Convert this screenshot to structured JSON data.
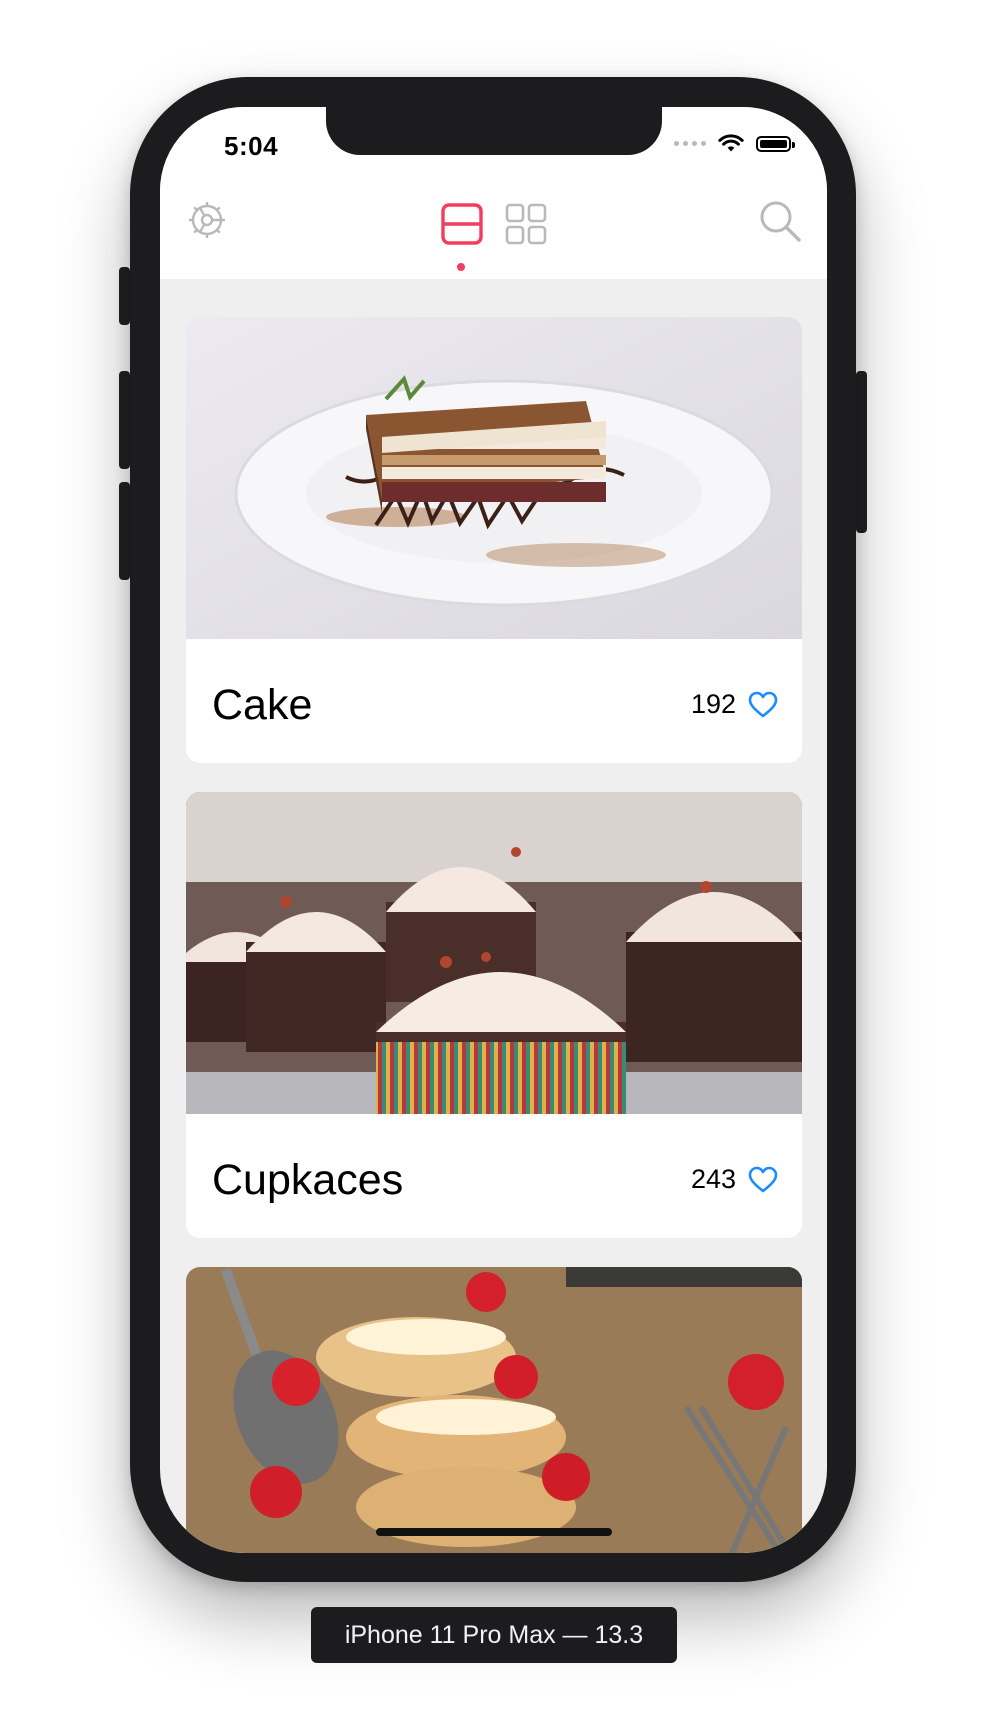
{
  "status_bar": {
    "time": "5:04"
  },
  "navbar": {
    "settings_icon": "gear-icon",
    "list_view_icon": "list-view-icon",
    "grid_view_icon": "grid-view-icon",
    "search_icon": "search-icon",
    "active_view": "list",
    "accent_color": "#f23d60",
    "inactive_color": "#b8b8bd"
  },
  "feed": {
    "items": [
      {
        "title": "Cake",
        "likes": "192",
        "image": "tiramisu cake slice on plate",
        "heart_icon": "heart-outline-icon"
      },
      {
        "title": "Cupkaces",
        "likes": "243",
        "image": "chocolate cupcakes with cream frosting",
        "heart_icon": "heart-outline-icon"
      },
      {
        "title": "",
        "likes": "",
        "image": "cream puffs with strawberries"
      }
    ],
    "heart_color": "#1a8cff"
  },
  "device_caption": "iPhone 11 Pro Max — 13.3"
}
